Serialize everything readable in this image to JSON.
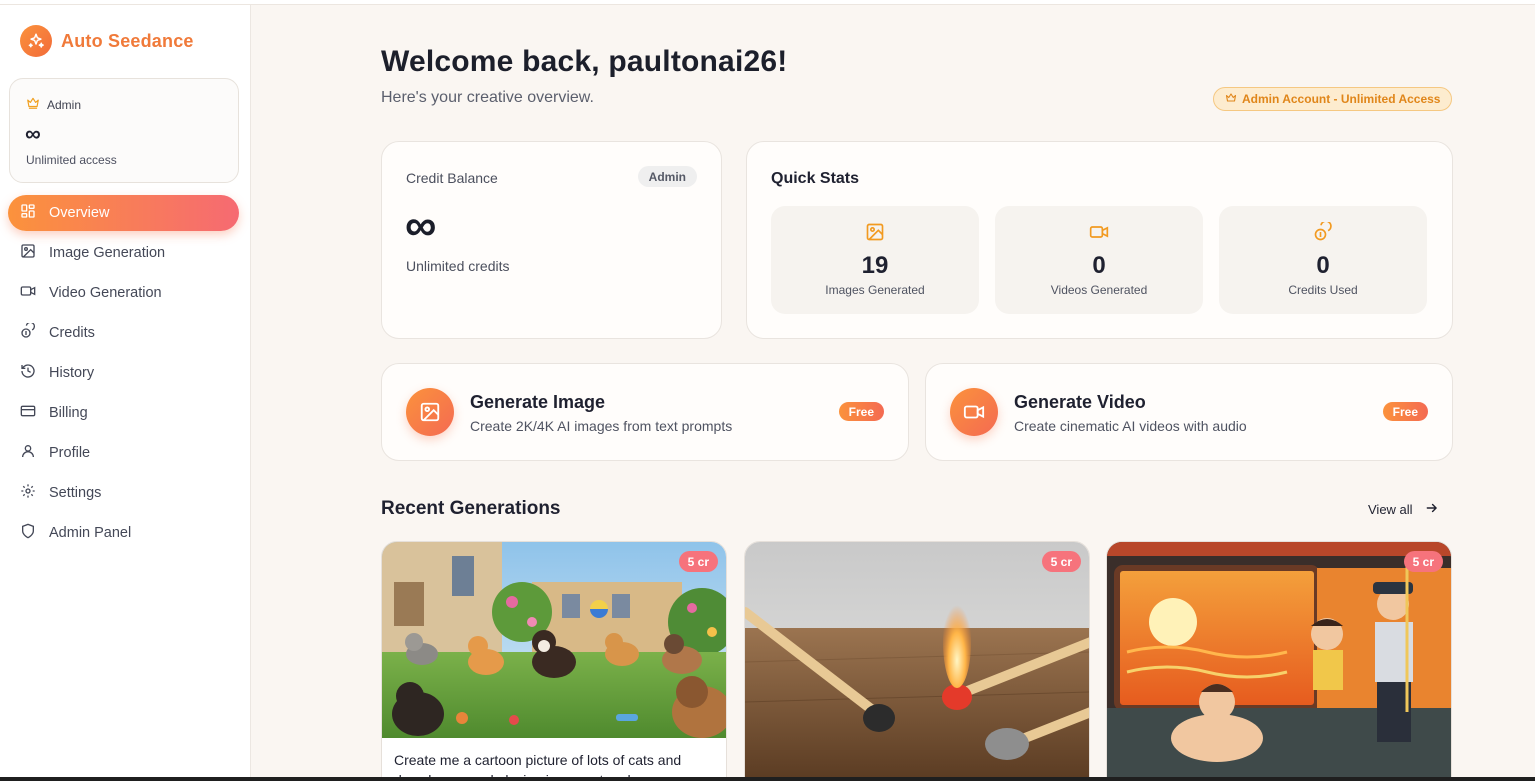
{
  "brand": {
    "name": "Auto Seedance"
  },
  "sidebar": {
    "account": {
      "role": "Admin",
      "credits": "∞",
      "access": "Unlimited access"
    },
    "items": [
      {
        "label": "Overview",
        "icon": "grid-icon",
        "active": true
      },
      {
        "label": "Image Generation",
        "icon": "image-icon"
      },
      {
        "label": "Video Generation",
        "icon": "video-icon"
      },
      {
        "label": "Credits",
        "icon": "coins-icon"
      },
      {
        "label": "History",
        "icon": "history-icon"
      },
      {
        "label": "Billing",
        "icon": "credit-card-icon"
      },
      {
        "label": "Profile",
        "icon": "user-icon"
      },
      {
        "label": "Settings",
        "icon": "gear-icon"
      },
      {
        "label": "Admin Panel",
        "icon": "shield-icon"
      }
    ]
  },
  "header": {
    "welcome": "Welcome back, paultonai26!",
    "subtitle": "Here's your creative overview.",
    "badge": "Admin Account - Unlimited Access"
  },
  "credit_balance": {
    "label": "Credit Balance",
    "pill": "Admin",
    "value": "∞",
    "desc": "Unlimited credits"
  },
  "quick_stats": {
    "title": "Quick Stats",
    "items": [
      {
        "value": "19",
        "label": "Images Generated",
        "icon": "image-icon"
      },
      {
        "value": "0",
        "label": "Videos Generated",
        "icon": "video-icon"
      },
      {
        "value": "0",
        "label": "Credits Used",
        "icon": "coins-icon"
      }
    ]
  },
  "actions": {
    "image": {
      "title": "Generate Image",
      "desc": "Create 2K/4K AI images from text prompts",
      "badge": "Free"
    },
    "video": {
      "title": "Generate Video",
      "desc": "Create cinematic AI videos with audio",
      "badge": "Free"
    }
  },
  "recent": {
    "title": "Recent Generations",
    "view_all": "View all",
    "items": [
      {
        "cost": "5 cr",
        "prompt": "Create me a cartoon picture of lots of cats and dogs happy and playing in a courtyard"
      },
      {
        "cost": "5 cr",
        "prompt": ""
      },
      {
        "cost": "5 cr",
        "prompt": ""
      }
    ]
  },
  "colors": {
    "accent": "#fb923c",
    "accent_pink": "#f66a72",
    "background": "#faf6f2"
  }
}
